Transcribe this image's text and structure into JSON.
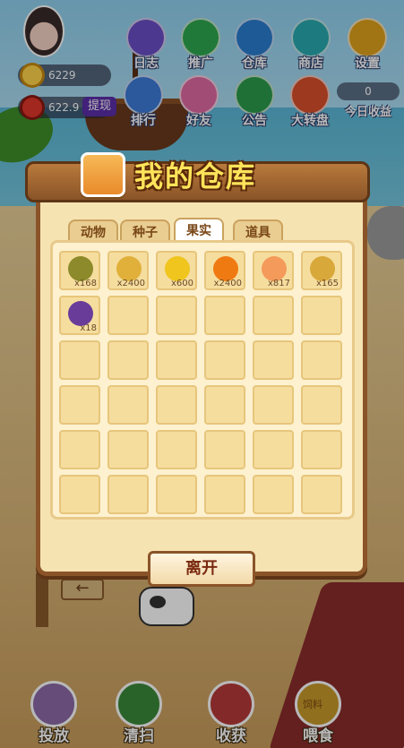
{
  "player": {
    "coins": "6229",
    "cash": "622.9",
    "withdraw_label": "提现",
    "today_value": "0",
    "today_label": "今日收益"
  },
  "top_menu": [
    {
      "label": "日志",
      "icon": "book-icon",
      "color": "#6a4fc7"
    },
    {
      "label": "推广",
      "icon": "bird-icon",
      "color": "#2fa84f"
    },
    {
      "label": "仓库",
      "icon": "warehouse-icon",
      "color": "#2a7ed0"
    },
    {
      "label": "商店",
      "icon": "shop-icon",
      "color": "#29a9b0"
    },
    {
      "label": "设置",
      "icon": "gear-icon",
      "color": "#e0a21d"
    },
    {
      "label": "排行",
      "icon": "ranking-icon",
      "color": "#3d7ad8"
    },
    {
      "label": "好友",
      "icon": "friends-icon",
      "color": "#e06aa2"
    },
    {
      "label": "公告",
      "icon": "megaphone-icon",
      "color": "#2b9b4d"
    },
    {
      "label": "大转盘",
      "icon": "wheel-icon",
      "color": "#d84f2a"
    }
  ],
  "warehouse": {
    "title": "我的仓库",
    "tabs": [
      {
        "label": "动物",
        "active": false
      },
      {
        "label": "种子",
        "active": false
      },
      {
        "label": "果实",
        "active": true
      },
      {
        "label": "道具",
        "active": false
      }
    ],
    "items": [
      {
        "icon": "kiwi-icon",
        "qty": "x168",
        "color": "#8c8a2a"
      },
      {
        "icon": "wheat-icon",
        "qty": "x2400",
        "color": "#e0b03a"
      },
      {
        "icon": "corn-icon",
        "qty": "x600",
        "color": "#f0c51e"
      },
      {
        "icon": "pumpkin-icon",
        "qty": "x2400",
        "color": "#f07a12"
      },
      {
        "icon": "peach-icon",
        "qty": "x817",
        "color": "#f49a5a"
      },
      {
        "icon": "grain-icon",
        "qty": "x165",
        "color": "#d8a83a"
      },
      {
        "icon": "grape-icon",
        "qty": "x18",
        "color": "#6a3c9a"
      }
    ],
    "total_slots": 36,
    "leave_label": "离开"
  },
  "bottom_bar": [
    {
      "label": "投放",
      "icon": "pig-icon",
      "color": "#8c6aa8"
    },
    {
      "label": "清扫",
      "icon": "broom-icon",
      "color": "#3a8a3a"
    },
    {
      "label": "收获",
      "icon": "harvest-icon",
      "color": "#b83a3a"
    },
    {
      "label": "喂食",
      "icon": "feed-icon",
      "color": "#c89a2a"
    }
  ],
  "feed_badge": "饲料",
  "back_arrow": "←"
}
